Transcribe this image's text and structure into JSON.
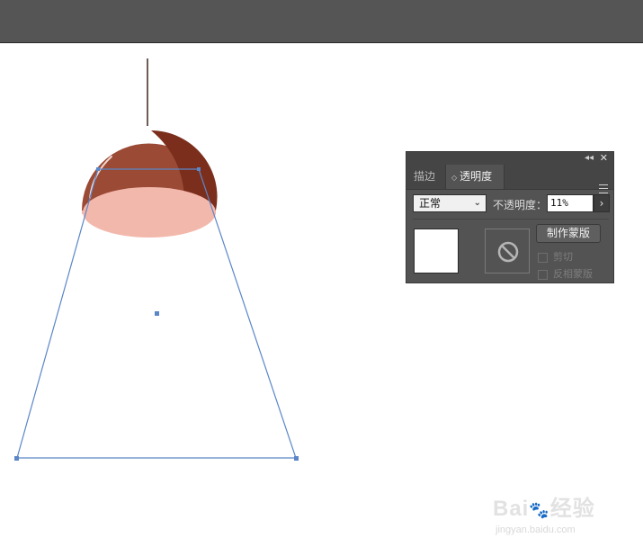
{
  "panel": {
    "tabs": [
      {
        "label": "描边"
      },
      {
        "label": "透明度"
      }
    ],
    "blend_mode": "正常",
    "opacity_label": "不透明度：",
    "opacity_value": "11%",
    "make_mask_label": "制作蒙版",
    "clip_label": "剪切",
    "invert_mask_label": "反相蒙版",
    "clip_checked": false,
    "invert_checked": false
  },
  "watermark": {
    "brand": "Bai",
    "brand_suffix": "经验",
    "url": "jingyan.baidu.com"
  },
  "colors": {
    "topbar": "#555555",
    "panel_bg": "#535353",
    "lamp_shade": "#9a4a35",
    "lamp_shade_dark": "#7b2e1c",
    "lamp_inner": "#f3b8ac",
    "lamp_cord": "#6d5d56",
    "selection": "#5b86c8"
  },
  "icons": {
    "panel_close": "close-icon",
    "panel_collapse": "double-chevron-left-icon",
    "panel_menu": "hamburger-menu-icon",
    "mask_disabled": "prohibited-icon"
  }
}
